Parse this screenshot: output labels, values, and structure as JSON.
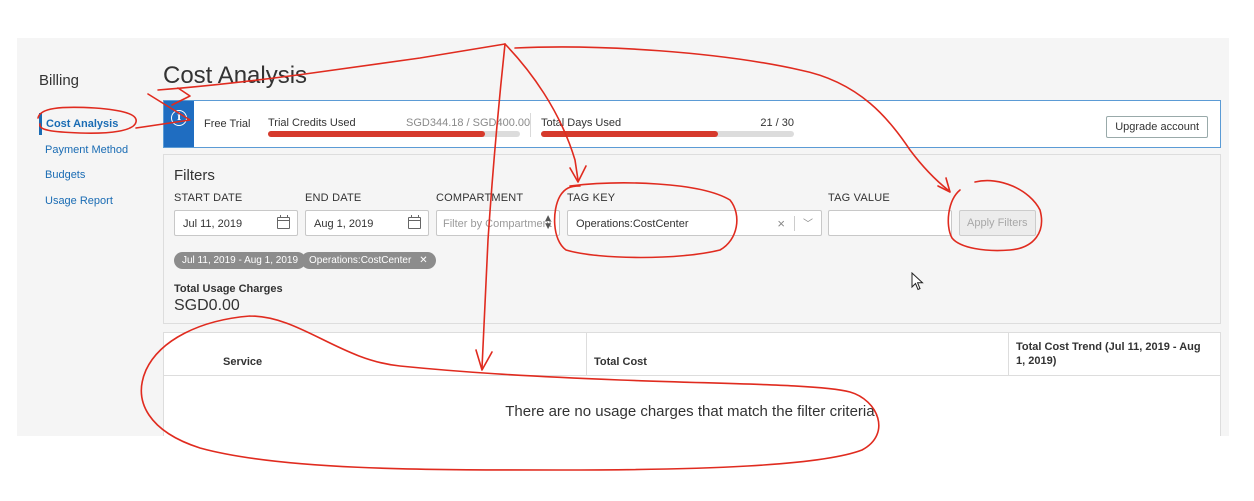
{
  "sidebar": {
    "title": "Billing",
    "items": [
      {
        "label": "Cost Analysis",
        "active": true
      },
      {
        "label": "Payment Method",
        "active": false
      },
      {
        "label": "Budgets",
        "active": false
      },
      {
        "label": "Usage Report",
        "active": false
      }
    ]
  },
  "page": {
    "title": "Cost Analysis"
  },
  "banner": {
    "icon": "info-icon",
    "free_trial": "Free Trial",
    "credits_label": "Trial Credits Used",
    "credits_value": "SGD344.18 / SGD400.00",
    "credits_fraction": 0.86,
    "days_label": "Total Days Used",
    "days_value": "21 / 30",
    "days_fraction": 0.7,
    "upgrade_label": "Upgrade account",
    "accent": "#1f6dc1",
    "bar_color": "#d63a2c"
  },
  "filters": {
    "title": "Filters",
    "start_label": "START DATE",
    "start_value": "Jul 11, 2019",
    "end_label": "END DATE",
    "end_value": "Aug 1, 2019",
    "compartment_label": "COMPARTMENT",
    "compartment_placeholder": "Filter by Compartment",
    "tag_key_label": "TAG KEY",
    "tag_key_value": "Operations:CostCenter",
    "tag_value_label": "TAG VALUE",
    "tag_value_value": "",
    "apply_label": "Apply Filters",
    "chips": [
      {
        "label": "Jul 11, 2019 - Aug 1, 2019",
        "removable": false
      },
      {
        "label": "Operations:CostCenter",
        "removable": true
      }
    ],
    "total_label": "Total Usage Charges",
    "total_value": "SGD0.00"
  },
  "table": {
    "columns": [
      "Service",
      "Total Cost",
      "Total Cost Trend (Jul 11, 2019 - Aug 1, 2019)"
    ],
    "empty_message": "There are no usage charges that match the filter criteria."
  },
  "annotation_color": "#e02b1f"
}
